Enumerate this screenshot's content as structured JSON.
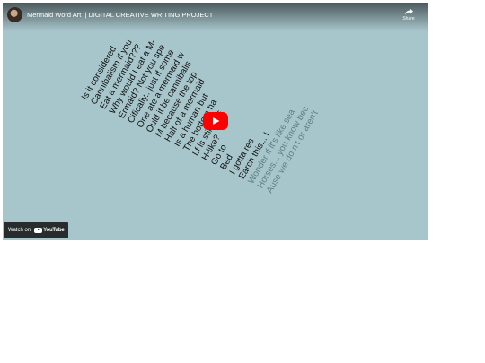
{
  "video": {
    "title": "Mermaid Word Art || DIGITAL CREATIVE WRITING PROJECT",
    "share_label": "Share",
    "watch_on_label": "Watch on",
    "youtube_label": "YouTube",
    "poem_lines": [
      {
        "text": "Is it considered",
        "style": "dark"
      },
      {
        "text": "Cannibalism if you",
        "style": "dark"
      },
      {
        "text": "Eat a mermaid???",
        "style": "dark"
      },
      {
        "text": "Why would I eat a M-",
        "style": "dark"
      },
      {
        "text": "Ermaid? Not you spe",
        "style": "dark"
      },
      {
        "text": "Cifically.. just if some",
        "style": "dark"
      },
      {
        "text": "One ate a mermaid w",
        "style": "dark"
      },
      {
        "text": "Ould it be cannibalis",
        "style": "dark"
      },
      {
        "text": "M because the top",
        "style": "dark"
      },
      {
        "text": "Half of a mermaid",
        "style": "dark"
      },
      {
        "text": "Is a human but",
        "style": "dark"
      },
      {
        "text": "The bottom ha",
        "style": "dark"
      },
      {
        "text": "Lf is still a fis",
        "style": "dark"
      },
      {
        "text": "H-like?",
        "style": "dark"
      },
      {
        "text": "Go to",
        "style": "dark"
      },
      {
        "text": "Bed",
        "style": "dark"
      },
      {
        "text": "I gotta res",
        "style": "dark"
      },
      {
        "text": "Earch this... I",
        "style": "dark"
      },
      {
        "text": "Wonder if it's like sea",
        "style": "faded"
      },
      {
        "text": "Horses... you know bec",
        "style": "faded"
      },
      {
        "text": "Ause we do  n't or aren't",
        "style": "faded"
      }
    ]
  }
}
